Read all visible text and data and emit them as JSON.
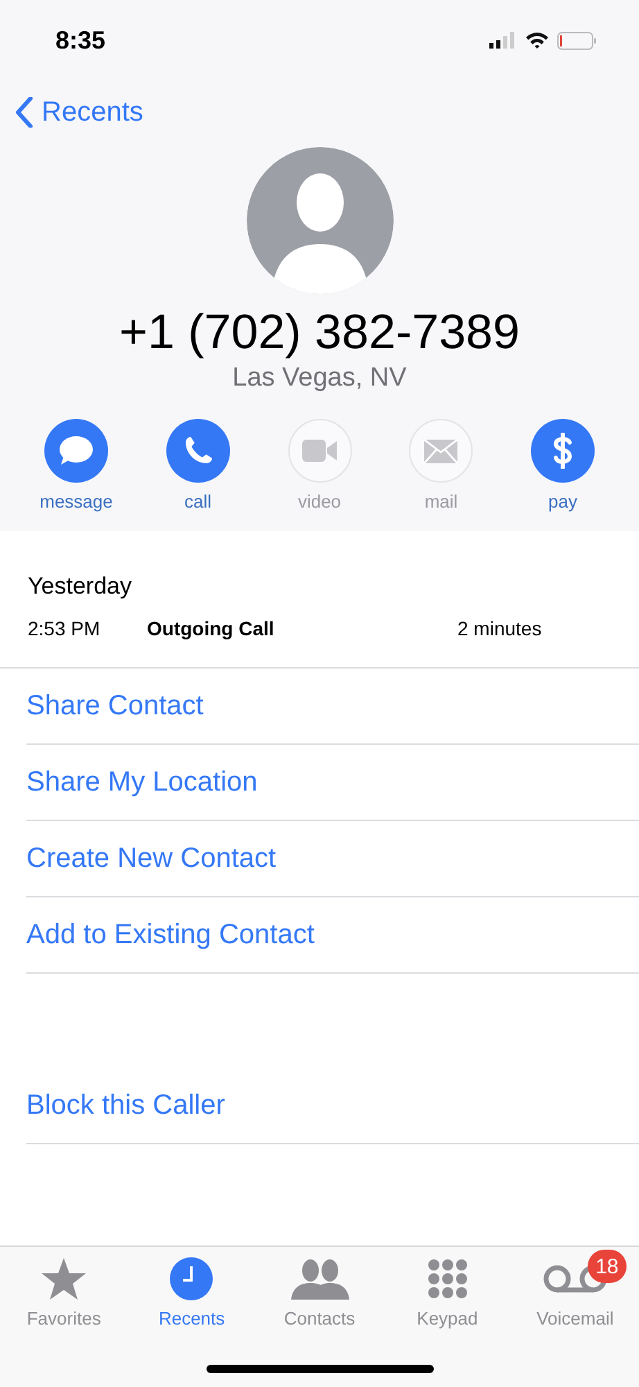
{
  "status_bar": {
    "time": "8:35"
  },
  "nav": {
    "back_label": "Recents"
  },
  "contact": {
    "number": "+1 (702) 382-7389",
    "location": "Las Vegas, NV"
  },
  "actions": [
    {
      "kind": "message",
      "label": "message",
      "disabled": false
    },
    {
      "kind": "call",
      "label": "call",
      "disabled": false
    },
    {
      "kind": "video",
      "label": "video",
      "disabled": true
    },
    {
      "kind": "mail",
      "label": "mail",
      "disabled": true
    },
    {
      "kind": "pay",
      "label": "pay",
      "disabled": false
    }
  ],
  "history": {
    "day": "Yesterday",
    "entries": [
      {
        "time": "2:53 PM",
        "type": "Outgoing Call",
        "duration": "2 minutes"
      }
    ]
  },
  "options": [
    "Share Contact",
    "Share My Location",
    "Create New Contact",
    "Add to Existing Contact"
  ],
  "block_option": "Block this Caller",
  "tabs": [
    {
      "kind": "favorites",
      "label": "Favorites",
      "selected": false
    },
    {
      "kind": "recents",
      "label": "Recents",
      "selected": true
    },
    {
      "kind": "contacts",
      "label": "Contacts",
      "selected": false
    },
    {
      "kind": "keypad",
      "label": "Keypad",
      "selected": false
    },
    {
      "kind": "voicemail",
      "label": "Voicemail",
      "selected": false,
      "badge": "18"
    }
  ]
}
